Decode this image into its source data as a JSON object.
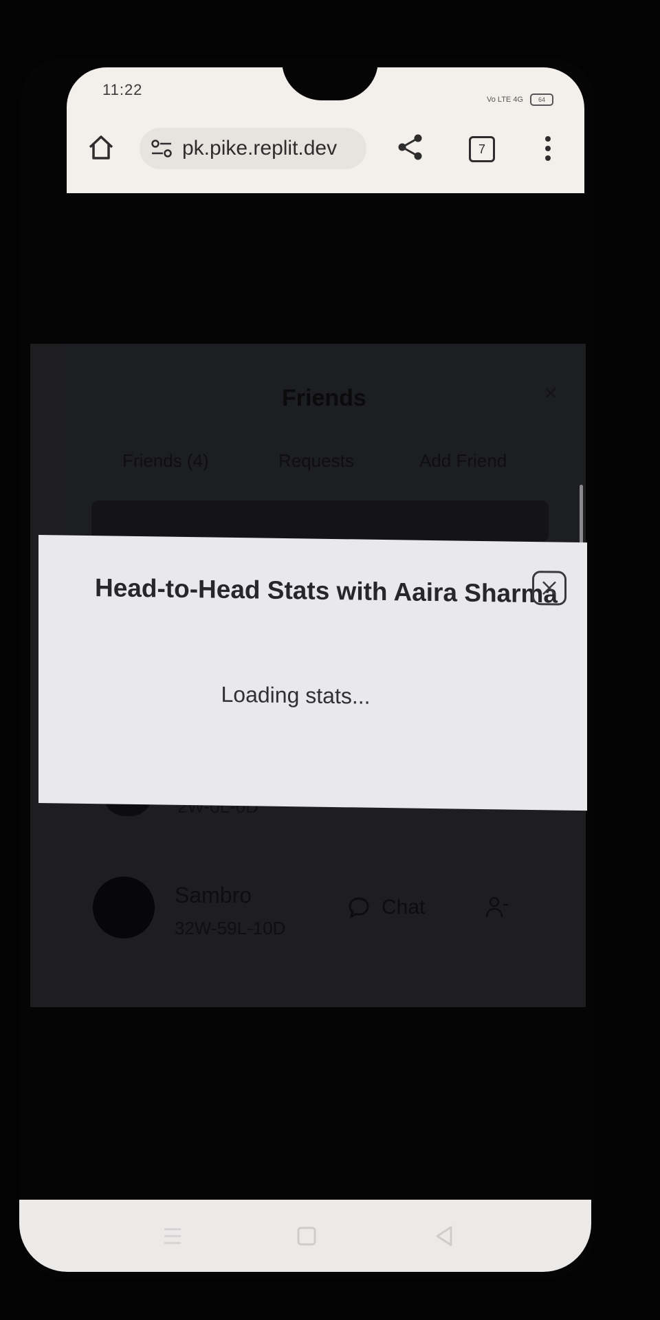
{
  "status_bar": {
    "time": "11:22",
    "signal_labels": "Vo LTE 4G",
    "battery": "64"
  },
  "browser": {
    "url": "pk.pike.replit.dev",
    "tab_count": "7"
  },
  "background_page": {
    "title": "Friends",
    "tabs": [
      "Friends (4)",
      "Requests",
      "Add Friend"
    ],
    "partial_record": "2W-0L-0D",
    "friend": {
      "name": "Sambro",
      "record": "32W-59L-10D",
      "chat_label": "Chat"
    }
  },
  "modal": {
    "title": "Head-to-Head Stats with Aaira Sharma",
    "loading_text": "Loading stats..."
  },
  "icons": {
    "home": "home-icon",
    "site_settings": "tune-icon",
    "share": "share-icon",
    "menu": "more-vert-icon",
    "close": "close-icon",
    "chat": "chat-bubble-icon",
    "remove_friend": "person-remove-icon"
  }
}
